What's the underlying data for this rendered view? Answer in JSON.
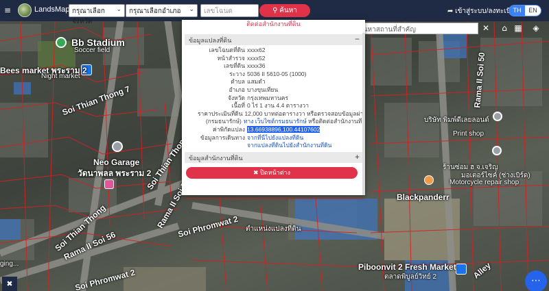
{
  "topbar": {
    "menu_icon": "≡",
    "brand": "LandsMaps",
    "province_select": "กรุณาเลือกจังหวัด",
    "district_select": "กรุณาเลือกอำเภอ",
    "deed_placeholder": "เลขโฉนด",
    "search_button": "ค้นหา",
    "login_link": "เข้าสู่ระบบ/ลงทะเบียน",
    "lang_th": "TH",
    "lang_en": "EN"
  },
  "tools": {
    "place_search_placeholder": "ค้นหาสถานที่สำคัญ",
    "clear": "✕"
  },
  "popup": {
    "top_link": "ติดต่อสำนักงานที่ดิน",
    "section_land": "ข้อมูลแปลงที่ดิน",
    "section_land_sign": "−",
    "section_office": "ข้อมูลสำนักงานที่ดิน",
    "section_office_sign": "+",
    "rows": [
      {
        "key": "เลขโฉนดที่ดิน",
        "value": "xxxx62"
      },
      {
        "key": "หน้าสำรวจ",
        "value": "xxxx52"
      },
      {
        "key": "เลขที่ดิน",
        "value": "xxxx36"
      },
      {
        "key": "ระวาง",
        "value": "5036 II 5610-05 (1000)"
      },
      {
        "key": "ตำบล",
        "value": "แสมดำ"
      },
      {
        "key": "อำเภอ",
        "value": "บางขุนเทียน"
      },
      {
        "key": "จังหวัด",
        "value": "กรุงเทพมหานคร"
      },
      {
        "key": "เนื้อที่",
        "value": "0 ไร่ 1 งาน 4.4 ตารางวา"
      },
      {
        "key": "ราคาประเมินที่ดิน",
        "value": "12,000 บาทต่อตารางวา หรือตรวจสอบข้อมูลผ่าน"
      },
      {
        "key": "(กรมธนารักษ์)",
        "value_link": "ทาง เว็บไซต์กรมธนารักษ์",
        "value_rest": " หรือติดต่อสำนักงานที่ดิน"
      },
      {
        "key": "ค่าพิกัดแปลง",
        "value_highlight": "13.66938896,100.44107602"
      },
      {
        "key": "ข้อมูลการเดินทาง",
        "value_link": "จากที่นี่ไปยังแปลงที่ดิน"
      },
      {
        "key": "",
        "value_link": "จากแปลงที่ดินไปยังสำนักงานที่ดิน"
      }
    ],
    "close_button": "ปิดหน้าต่าง"
  },
  "map": {
    "labels": [
      {
        "name": "bb-stadium",
        "text": "Bb Stadium",
        "size": "lg"
      },
      {
        "name": "bb-soccer-field",
        "text": "Soccer field",
        "size": "sm"
      },
      {
        "name": "bees-market",
        "text": "Bees market พระราม 2",
        "size": "md"
      },
      {
        "name": "night-market",
        "text": "Night market",
        "size": "sm"
      },
      {
        "name": "soi-thian-thong-7",
        "text": "Soi Thian Thong 7",
        "size": "md"
      },
      {
        "name": "neo-garage",
        "text": "Neo Garage",
        "size": "md"
      },
      {
        "name": "wat-label",
        "text": "วัดนาพลล พระราม 2",
        "size": "md"
      },
      {
        "name": "soi-thian-thong",
        "text": "Soi Thian Thong",
        "size": "md"
      },
      {
        "name": "soi-thian-thong-b",
        "text": "Soi Thian Thong",
        "size": "md"
      },
      {
        "name": "rama-ii-soi-56",
        "text": "Rama II Soi 56",
        "size": "md"
      },
      {
        "name": "rama-ii-soi-50",
        "text": "Rama II Soi 50",
        "size": "md"
      },
      {
        "name": "rama-ii-soi-56-b",
        "text": "Rama II Soi 56",
        "size": "md"
      },
      {
        "name": "soi-phromwat-2",
        "text": "Soi Phromwat 2",
        "size": "md"
      },
      {
        "name": "soi-phromwat-2-b",
        "text": "Soi Phromwat 2",
        "size": "md"
      },
      {
        "name": "parcel-location",
        "text": "ตำแหน่งแปลงที่ดิน",
        "size": "sm"
      },
      {
        "name": "print-shop-thai",
        "text": "บริษัท พิมพ์ดีเลยลอนด์",
        "size": "sm"
      },
      {
        "name": "print-shop",
        "text": "Print shop",
        "size": "sm"
      },
      {
        "name": "motorcycle-shop-thai",
        "text": "ร้านซ่อม ฮ จ.เจริญ",
        "size": "sm"
      },
      {
        "name": "motorcycle-shop-thai2",
        "text": "มอเตอร์ไซค์ (ช่างเบิร์ด)",
        "size": "sm"
      },
      {
        "name": "motorcycle-shop",
        "text": "Motorcycle repair shop",
        "size": "sm"
      },
      {
        "name": "blackpanderr",
        "text": "Blackpanderr",
        "size": "md"
      },
      {
        "name": "piboonvit-market",
        "text": "Piboonvit 2 Fresh Market",
        "size": "md"
      },
      {
        "name": "piboonvit-thai",
        "text": "ตลาดพิบูลย์วิทย์ 2",
        "size": "sm"
      },
      {
        "name": "alley",
        "text": "Alley",
        "size": "md"
      },
      {
        "name": "pawana-label",
        "text": "ging...",
        "size": "sm"
      }
    ]
  },
  "pin_icon": "map-pin-icon",
  "chat_icon": "chat-bubble-icon",
  "colors": {
    "accent": "#e0334a",
    "nav": "#1f2a44",
    "link": "#1a55c4",
    "highlight": "#2563eb"
  }
}
